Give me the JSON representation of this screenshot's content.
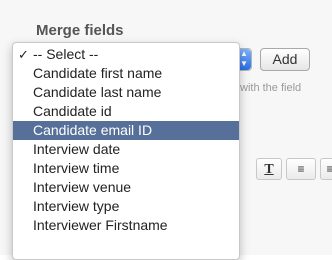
{
  "section": {
    "title": "Merge fields"
  },
  "add_button": {
    "label": "Add"
  },
  "hint_text": "with the field",
  "toolbar": {
    "clear_format_glyph": "T",
    "align_glyph": "≡",
    "align2_glyph": "≡"
  },
  "dropdown": {
    "selected_check": "✓",
    "options": [
      "-- Select --",
      "Candidate first name",
      "Candidate last name",
      "Candidate id",
      "Candidate email ID",
      "Interview date",
      "Interview time",
      "Interview venue",
      "Interview type",
      "Interviewer Firstname"
    ],
    "selected_index": 0,
    "highlighted_index": 4
  },
  "colors": {
    "highlight": "#56709a",
    "select_arrow": "#2a6ee6"
  }
}
